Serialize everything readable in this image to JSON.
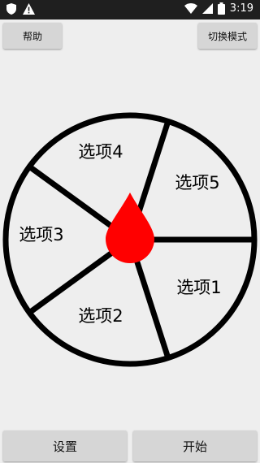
{
  "status_bar": {
    "time": "3:19",
    "icons": [
      "shield-icon",
      "warning-icon",
      "wifi-icon",
      "signal-icon",
      "battery-icon"
    ]
  },
  "toolbar": {
    "help_label": "帮助",
    "switch_mode_label": "切换模式"
  },
  "wheel": {
    "options": [
      "选项1",
      "选项2",
      "选项3",
      "选项4",
      "选项5"
    ],
    "pointer_color": "#ff0000",
    "line_color": "#000000"
  },
  "bottom_bar": {
    "settings_label": "设置",
    "start_label": "开始"
  }
}
